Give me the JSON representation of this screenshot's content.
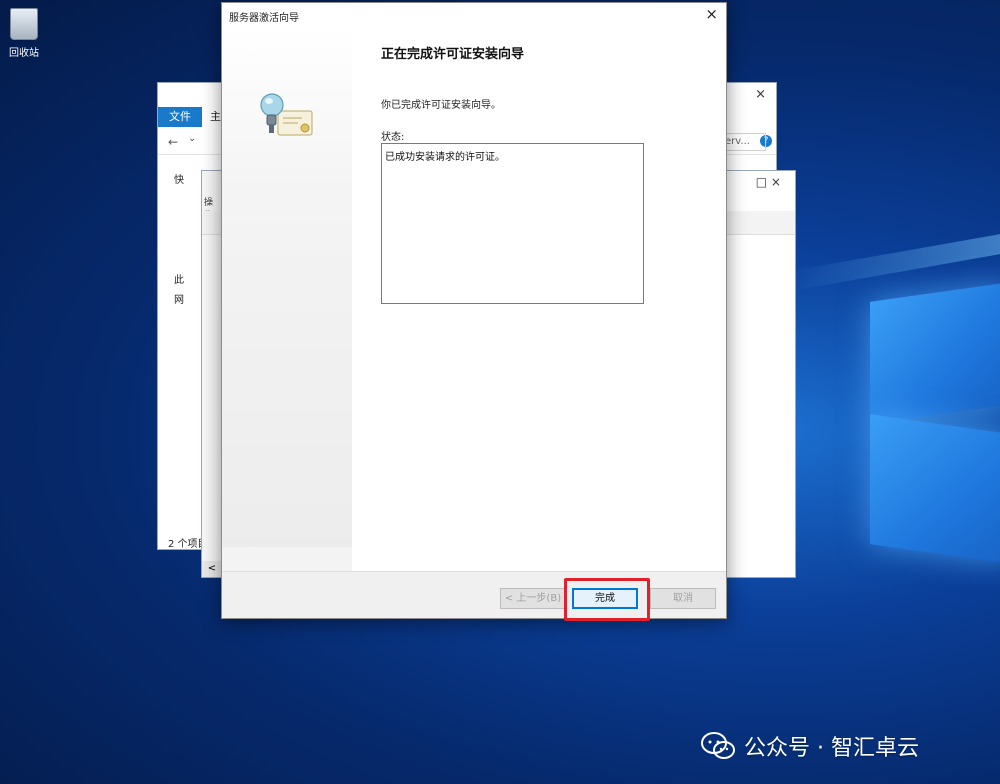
{
  "desktop": {
    "recycle_bin_label": "回收站"
  },
  "explorer": {
    "tab_file": "文件",
    "tab_home": "主",
    "search_text": "erv...",
    "close": "×",
    "help": "?",
    "nav_back": "←",
    "nav_down": "⌄",
    "sidebar_items": [
      "快",
      "",
      "",
      "",
      "",
      "此",
      "网"
    ],
    "status": "2 个项目"
  },
  "manager": {
    "window_controls": "□   ×",
    "toolbar_text": "操作",
    "scroll_left": "<"
  },
  "wizard": {
    "title": "服务器激活向导",
    "close": "×",
    "heading": "正在完成许可证安装向导",
    "description": "你已完成许可证安装向导。",
    "status_label": "状态:",
    "status_text": "已成功安装请求的许可证。",
    "buttons": {
      "back": "< 上一步(B)",
      "finish": "完成",
      "cancel": "取消"
    }
  },
  "watermark": {
    "text": "公众号 · 智汇卓云"
  },
  "colors": {
    "accent": "#0078d7",
    "highlight_box": "#e0202a",
    "ribbon_file_tab": "#1979ca"
  }
}
